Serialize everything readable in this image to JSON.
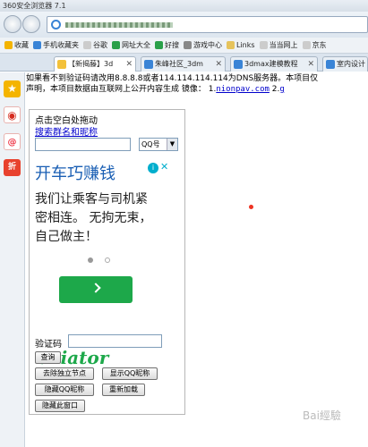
{
  "window": {
    "title": "360安全浏览器 7.1"
  },
  "bookmarks": [
    {
      "label": "收藏",
      "icon": "star-icon",
      "color": "#f4b400"
    },
    {
      "label": "手机收藏夹",
      "icon": "phone-icon",
      "color": "#3a84d6"
    },
    {
      "label": "谷歌",
      "icon": "page-icon",
      "color": "#ccc"
    },
    {
      "label": "网址大全",
      "icon": "globe-icon",
      "color": "#2aa04a"
    },
    {
      "label": "好搜",
      "icon": "search-icon",
      "color": "#2aa04a"
    },
    {
      "label": "游戏中心",
      "icon": "game-icon",
      "color": "#888"
    },
    {
      "label": "Links",
      "icon": "folder-icon",
      "color": "#e6c35c"
    },
    {
      "label": "当当网上",
      "icon": "page-icon",
      "color": "#ccc"
    },
    {
      "label": "京东",
      "icon": "page-icon",
      "color": "#ccc"
    }
  ],
  "tabs": [
    {
      "label": "【新揭藤】3d",
      "active": true
    },
    {
      "label": "朱峰社区_3dm"
    },
    {
      "label": "3dmax建模教程"
    },
    {
      "label": "室内设计"
    }
  ],
  "notice": {
    "line1": "如果看不到验证码请改用8.8.8.8或者114.114.114.114为DNS服务器。本项目仅",
    "line2_prefix": "声明，本项目数据由互联网上公开内容生成    镜像： 1.",
    "mirror1": "nionpav.com",
    "line2_sep": "  2.",
    "mirror2": "g"
  },
  "panel": {
    "drag_hint": "点击空白处拖动",
    "search_link": "搜索群名和昵称",
    "nick_placeholder": "",
    "select_value": "QQ号",
    "ad": {
      "title": "开车巧赚钱",
      "body": [
        "我们让乘客与司机紧",
        "密相连。 无拘无束，",
        "自己做主！"
      ],
      "logo": "aviator",
      "info": "i",
      "close": "✕"
    },
    "captcha_label": "验证码",
    "buttons": {
      "query": "查询",
      "remove": "去除独立节点",
      "show": "显示QQ昵称",
      "hide": "隐藏QQ昵称",
      "reload": "重新加载",
      "hide_window": "隐藏此窗口"
    }
  },
  "sidebar": {
    "star": "★",
    "weibo": "◉",
    "at": "@",
    "discount": "折"
  },
  "watermark": "Bai經驗"
}
